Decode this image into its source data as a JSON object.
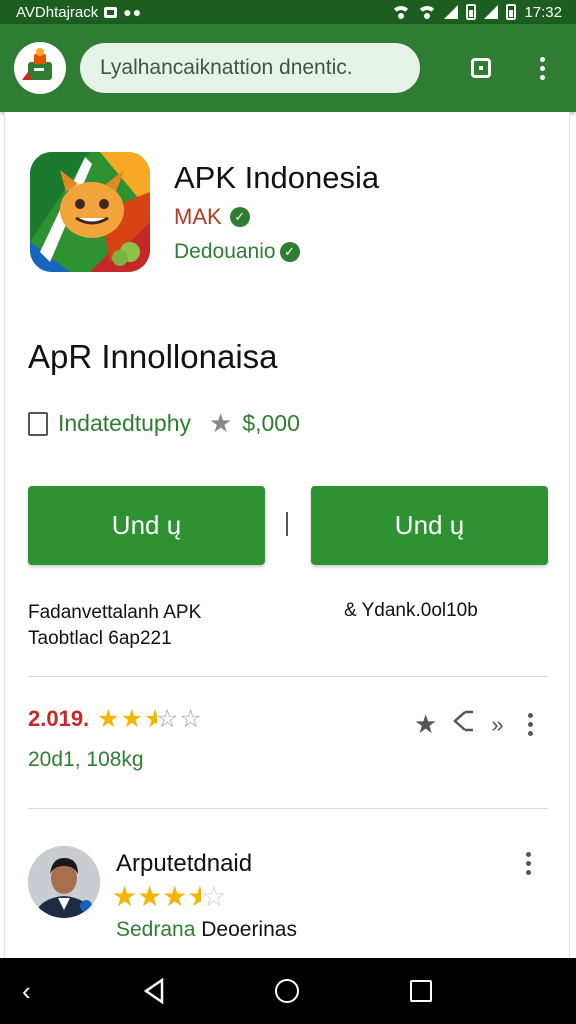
{
  "status_bar": {
    "carrier": "AVDhtajrack",
    "time": "17:32"
  },
  "app_bar": {
    "search_text": "Lyalhancaiknattion dnentic."
  },
  "app": {
    "title": "APK Indonesia",
    "developer": "MAK",
    "tagline": "Dedouanio",
    "heading": "ApR Innollonaisa",
    "meta_label": "Indatedtuphy",
    "price": "$,000"
  },
  "buttons": {
    "left_label": "Und ų",
    "right_label": "Und ų"
  },
  "info": {
    "left_line1": "Fadanvettalanh APK",
    "left_line2": "Taobtlacl 6ap221",
    "right_line1": "& Ydank.0ol10b"
  },
  "rating": {
    "value": "2.019.",
    "stars_filled": 2.5,
    "stats": "20d1, 108kg"
  },
  "review": {
    "name": "Arputetdnaid",
    "stars_filled": 3.5,
    "subtitle_green": "Sedrana",
    "subtitle_rest": " Deoerinas"
  },
  "icons": {
    "statusbar": [
      "notification-box-icon",
      "more-dots-icon",
      "wifi-icon",
      "signal-icon",
      "battery-icon"
    ],
    "appbar": [
      "app-logo-icon",
      "tab-square-icon",
      "overflow-menu-icon"
    ],
    "rating_actions": [
      "star-icon",
      "share-icon",
      "forward-icon",
      "overflow-menu-icon"
    ],
    "navbar": [
      "back-icon",
      "home-icon",
      "recents-icon"
    ]
  },
  "colors": {
    "status_bar": "#1b5e20",
    "app_bar": "#2e7d32",
    "button": "#2e9232",
    "accent_text": "#2e7d32",
    "developer_text": "#b23a1e",
    "rating_text": "#c62828",
    "star": "#f4b400"
  }
}
